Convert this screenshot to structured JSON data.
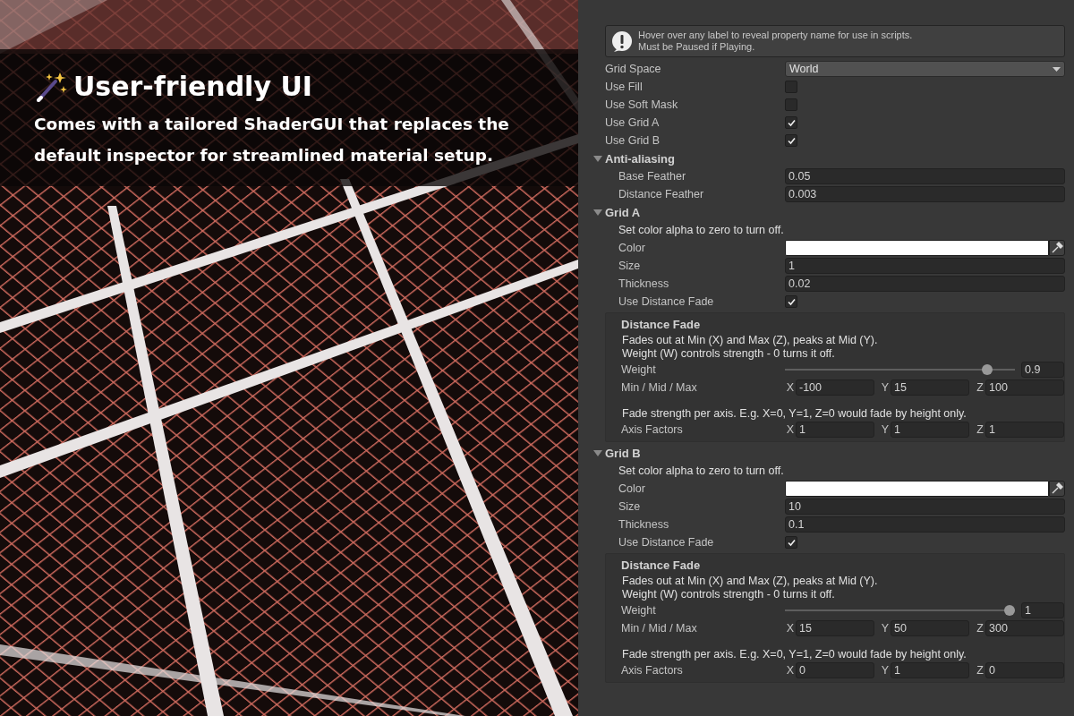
{
  "promo": {
    "title": "User-friendly UI",
    "description": "Comes with a tailored ShaderGUI that replaces the default inspector for streamlined material setup."
  },
  "inspector": {
    "help_lines": [
      "Hover over any label to reveal property name for use in scripts.",
      "Must be Paused if Playing."
    ],
    "rows": [
      {
        "kind": "dropdown",
        "label": "Grid Space",
        "value": "World"
      },
      {
        "kind": "checkbox",
        "label": "Use Fill",
        "checked": false
      },
      {
        "kind": "checkbox",
        "label": "Use Soft Mask",
        "checked": false
      },
      {
        "kind": "checkbox",
        "label": "Use Grid A",
        "checked": true
      },
      {
        "kind": "checkbox",
        "label": "Use Grid B",
        "checked": true
      },
      {
        "kind": "section",
        "label": "Anti-aliasing",
        "expanded": true,
        "children": [
          {
            "kind": "number",
            "label": "Base Feather",
            "value": "0.05"
          },
          {
            "kind": "number",
            "label": "Distance Feather",
            "value": "0.003"
          }
        ]
      },
      {
        "kind": "section",
        "label": "Grid A",
        "expanded": true,
        "children": [
          {
            "kind": "note",
            "text": "Set color alpha to zero to turn off."
          },
          {
            "kind": "color",
            "label": "Color",
            "color": "#ffffff"
          },
          {
            "kind": "number",
            "label": "Size",
            "value": "1"
          },
          {
            "kind": "number",
            "label": "Thickness",
            "value": "0.02"
          },
          {
            "kind": "checkbox",
            "label": "Use Distance Fade",
            "checked": true
          },
          {
            "kind": "group",
            "title": "Distance Fade",
            "children": [
              {
                "kind": "note",
                "text": "Fades out at Min (X) and Max (Z), peaks at Mid (Y)."
              },
              {
                "kind": "note",
                "text": "Weight (W) controls strength - 0 turns it off."
              },
              {
                "kind": "slider",
                "label": "Weight",
                "level": 0.9,
                "value": "0.9"
              },
              {
                "kind": "vector",
                "label": "Min / Mid / Max",
                "components": [
                  {
                    "axis": "X",
                    "value": "-100"
                  },
                  {
                    "axis": "Y",
                    "value": "15"
                  },
                  {
                    "axis": "Z",
                    "value": "100"
                  }
                ]
              },
              {
                "kind": "note",
                "text": "Fade strength per axis. E.g. X=0, Y=1, Z=0 would fade by height only."
              },
              {
                "kind": "vector",
                "label": "Axis Factors",
                "components": [
                  {
                    "axis": "X",
                    "value": "1"
                  },
                  {
                    "axis": "Y",
                    "value": "1"
                  },
                  {
                    "axis": "Z",
                    "value": "1"
                  }
                ]
              }
            ]
          }
        ]
      },
      {
        "kind": "section",
        "label": "Grid B",
        "expanded": true,
        "children": [
          {
            "kind": "note",
            "text": "Set color alpha to zero to turn off."
          },
          {
            "kind": "color",
            "label": "Color",
            "color": "#ffffff"
          },
          {
            "kind": "number",
            "label": "Size",
            "value": "10"
          },
          {
            "kind": "number",
            "label": "Thickness",
            "value": "0.1"
          },
          {
            "kind": "checkbox",
            "label": "Use Distance Fade",
            "checked": true
          },
          {
            "kind": "group",
            "title": "Distance Fade",
            "children": [
              {
                "kind": "note",
                "text": "Fades out at Min (X) and Max (Z), peaks at Mid (Y)."
              },
              {
                "kind": "note",
                "text": "Weight (W) controls strength - 0 turns it off."
              },
              {
                "kind": "slider",
                "label": "Weight",
                "level": 1,
                "value": "1"
              },
              {
                "kind": "vector",
                "label": "Min / Mid / Max",
                "components": [
                  {
                    "axis": "X",
                    "value": "15"
                  },
                  {
                    "axis": "Y",
                    "value": "50"
                  },
                  {
                    "axis": "Z",
                    "value": "300"
                  }
                ]
              },
              {
                "kind": "note",
                "text": "Fade strength per axis. E.g. X=0, Y=1, Z=0 would fade by height only."
              },
              {
                "kind": "vector",
                "label": "Axis Factors",
                "components": [
                  {
                    "axis": "X",
                    "value": "0"
                  },
                  {
                    "axis": "Y",
                    "value": "1"
                  },
                  {
                    "axis": "Z",
                    "value": "0"
                  }
                ]
              }
            ]
          }
        ]
      }
    ]
  }
}
